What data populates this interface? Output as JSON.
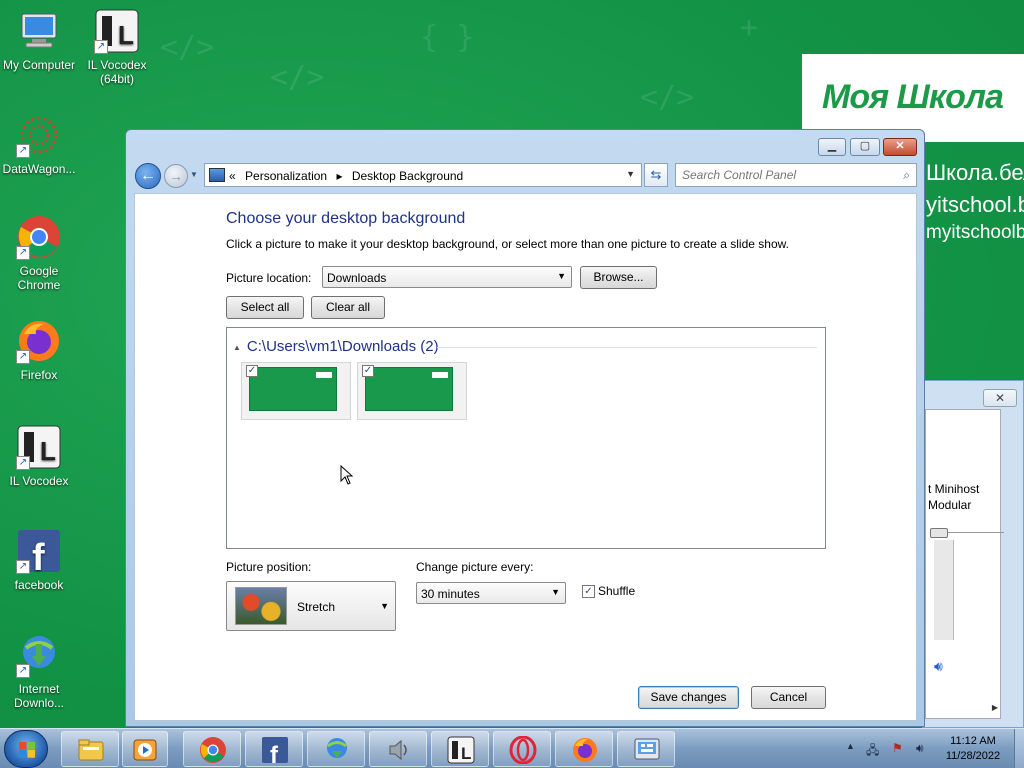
{
  "desktop": {
    "icons": [
      {
        "label": "My Computer",
        "icon": "computer-icon"
      },
      {
        "label": "IL Vocodex (64bit)",
        "icon": "il-vocodex-icon"
      },
      {
        "label": "DataWagon...",
        "icon": "datawagon-icon"
      },
      {
        "label": "Google Chrome",
        "icon": "chrome-icon"
      },
      {
        "label": "Firefox",
        "icon": "firefox-icon"
      },
      {
        "label": "IL Vocodex",
        "icon": "il-vocodex-icon"
      },
      {
        "label": "facebook",
        "icon": "facebook-icon"
      },
      {
        "label": "Internet Downlo...",
        "icon": "idm-icon"
      }
    ],
    "wallpaper": {
      "logo": "Моя Школа",
      "lines": [
        "Школа.бел",
        "yitschool.by",
        "myitschoolby"
      ]
    }
  },
  "background_window": {
    "close_label": "✕",
    "text_lines": [
      "t Minihost",
      "Modular"
    ]
  },
  "window": {
    "caption_buttons": {
      "minimize": "▁",
      "maximize": "▢",
      "close": "✕"
    },
    "breadcrumb": {
      "prefix": "«",
      "items": [
        "Personalization",
        "Desktop Background"
      ],
      "separator": "▸"
    },
    "search": {
      "placeholder": "Search Control Panel"
    },
    "title": "Choose your desktop background",
    "description": "Click a picture to make it your desktop background, or select more than one picture to create a slide show.",
    "picture_location": {
      "label": "Picture location:",
      "value": "Downloads",
      "browse_label": "Browse..."
    },
    "select_all_label": "Select all",
    "clear_all_label": "Clear all",
    "gallery": {
      "folder": "C:\\Users\\vm1\\Downloads (2)",
      "thumbnails": [
        {
          "checked": true
        },
        {
          "checked": true
        }
      ]
    },
    "picture_position": {
      "label": "Picture position:",
      "value": "Stretch"
    },
    "change_picture": {
      "label": "Change picture every:",
      "value": "30 minutes"
    },
    "shuffle": {
      "label": "Shuffle",
      "checked": true
    },
    "save_label": "Save changes",
    "cancel_label": "Cancel"
  },
  "taskbar": {
    "items": [
      "windows-explorer",
      "media-player",
      "google-chrome",
      "facebook",
      "internet-download-manager",
      "audio",
      "il-vocodex",
      "opera",
      "firefox",
      "control-panel"
    ],
    "clock": {
      "time": "11:12 AM",
      "date": "11/28/2022"
    }
  },
  "colors": {
    "wallpaper_green": "#139346",
    "title_blue": "#1e3287",
    "taskbar": "#7c9cc0"
  }
}
